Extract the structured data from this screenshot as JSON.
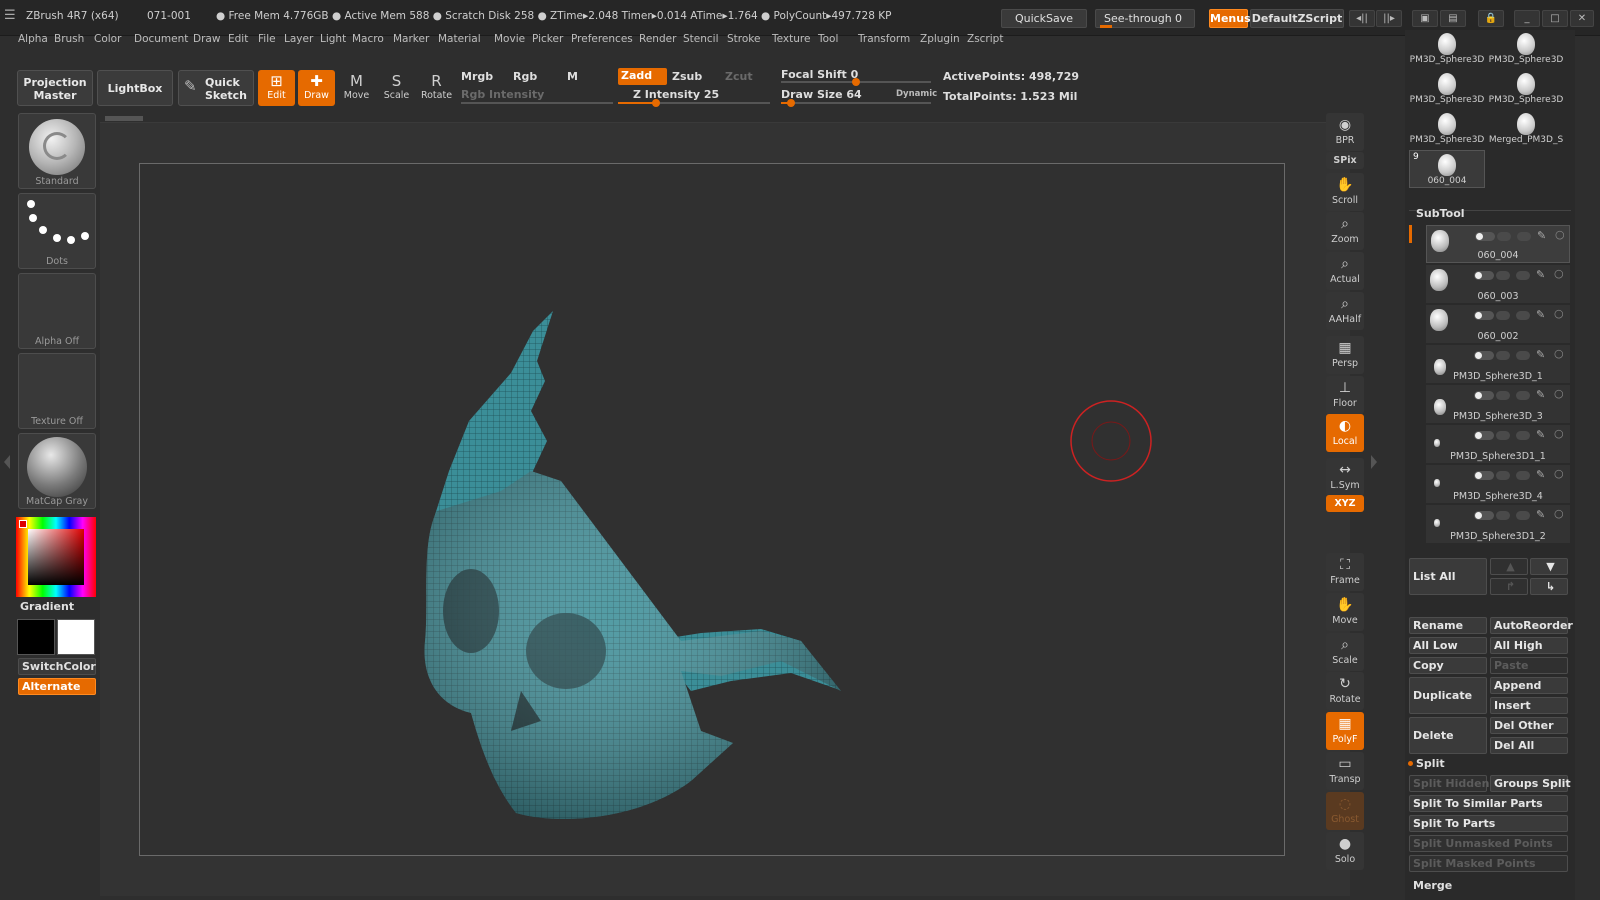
{
  "titlebar": {
    "app_title": "ZBrush 4R7 (x64)",
    "doc_id": "071-001",
    "stats": "● Free Mem 4.776GB ● Active Mem 588 ● Scratch Disk 258 ● ZTime▸2.048 Timer▸0.014 ATime▸1.764 ● PolyCount▸497.728 KP",
    "quicksave": "QuickSave",
    "seethrough": "See-through",
    "seethrough_val": "0",
    "menus": "Menus",
    "defaultscript": "DefaultZScript"
  },
  "menu": [
    "Alpha",
    "Brush",
    "Color",
    "Document",
    "Draw",
    "Edit",
    "File",
    "Layer",
    "Light",
    "Macro",
    "Marker",
    "Material",
    "Movie",
    "Picker",
    "Preferences",
    "Render",
    "Stencil",
    "Stroke",
    "Texture",
    "Tool",
    "Transform",
    "Zplugin",
    "Zscript"
  ],
  "toolbar": {
    "projection_master": "Projection Master",
    "lightbox": "LightBox",
    "quick_sketch": "Quick Sketch",
    "edit": "Edit",
    "draw": "Draw",
    "move": "Move",
    "scale": "Scale",
    "rotate": "Rotate",
    "mrgb": "Mrgb",
    "rgb": "Rgb",
    "m": "M",
    "rgb_intensity": "Rgb Intensity",
    "zadd": "Zadd",
    "zsub": "Zsub",
    "zcut": "Zcut",
    "z_intensity": "Z Intensity 25",
    "z_intensity_value": 25,
    "focal_shift": "Focal Shift 0",
    "focal_shift_value": 0,
    "draw_size": "Draw Size 64",
    "draw_size_value": 64,
    "dynamic": "Dynamic",
    "active_points": "ActivePoints: 498,729",
    "total_points": "TotalPoints: 1.523 Mil"
  },
  "left_shelf": {
    "brush": "Standard",
    "stroke": "Dots",
    "alpha": "Alpha Off",
    "texture": "Texture Off",
    "material": "MatCap Gray",
    "gradient": "Gradient",
    "switchcolor": "SwitchColor",
    "alternate": "Alternate"
  },
  "right_shelf": [
    {
      "label": "BPR",
      "icon": "bpr-icon",
      "on": false
    },
    {
      "label": "SPix",
      "icon": "spix-icon",
      "on": false
    },
    {
      "label": "Scroll",
      "icon": "scroll-icon",
      "on": false
    },
    {
      "label": "Zoom",
      "icon": "zoom-icon",
      "on": false
    },
    {
      "label": "Actual",
      "icon": "actual-icon",
      "on": false
    },
    {
      "label": "AAHalf",
      "icon": "aahalf-icon",
      "on": false
    },
    {
      "label": "Persp",
      "icon": "persp-icon",
      "on": false
    },
    {
      "label": "Floor",
      "icon": "floor-icon",
      "on": false
    },
    {
      "label": "Local",
      "icon": "local-icon",
      "on": true
    },
    {
      "label": "L.Sym",
      "icon": "lsym-icon",
      "on": false
    },
    {
      "label": "XYZ",
      "icon": "xyz-icon",
      "on": true
    },
    {
      "label": "Frame",
      "icon": "frame-icon",
      "on": false
    },
    {
      "label": "Move",
      "icon": "move-icon",
      "on": false
    },
    {
      "label": "Scale",
      "icon": "scale-icon",
      "on": false
    },
    {
      "label": "Rotate",
      "icon": "rotate-icon",
      "on": false
    },
    {
      "label": "PolyF",
      "icon": "polyf-icon",
      "on": true
    },
    {
      "label": "Transp",
      "icon": "transp-icon",
      "on": false
    },
    {
      "label": "Ghost",
      "icon": "ghost-icon",
      "on": false
    },
    {
      "label": "Solo",
      "icon": "solo-icon",
      "on": false
    }
  ],
  "tool_thumbs": [
    "PM3D_Sphere3D",
    "PM3D_Sphere3D",
    "PM3D_Sphere3D",
    "PM3D_Sphere3D",
    "PM3D_Sphere3D",
    "Merged_PM3D_S",
    "060_004"
  ],
  "tool_thumb_badge": "9",
  "subtool": {
    "title": "SubTool",
    "items": [
      "060_004",
      "060_003",
      "060_002",
      "PM3D_Sphere3D_1",
      "PM3D_Sphere3D_3",
      "PM3D_Sphere3D1_1",
      "PM3D_Sphere3D_4",
      "PM3D_Sphere3D1_2"
    ],
    "list_all": "List All",
    "rename": "Rename",
    "autoreorder": "AutoReorder",
    "all_low": "All Low",
    "all_high": "All High",
    "copy": "Copy",
    "paste": "Paste",
    "duplicate": "Duplicate",
    "append": "Append",
    "insert": "Insert",
    "delete": "Delete",
    "del_other": "Del Other",
    "del_all": "Del All",
    "split": "Split",
    "split_hidden": "Split Hidden",
    "groups_split": "Groups Split",
    "split_similar": "Split To Similar Parts",
    "split_parts": "Split To Parts",
    "split_unmasked": "Split Unmasked Points",
    "split_masked": "Split Masked Points",
    "merge": "Merge"
  },
  "colors": {
    "accent": "#e66a00",
    "mesh": "#3a8c96",
    "cursor": "#cc2222"
  }
}
